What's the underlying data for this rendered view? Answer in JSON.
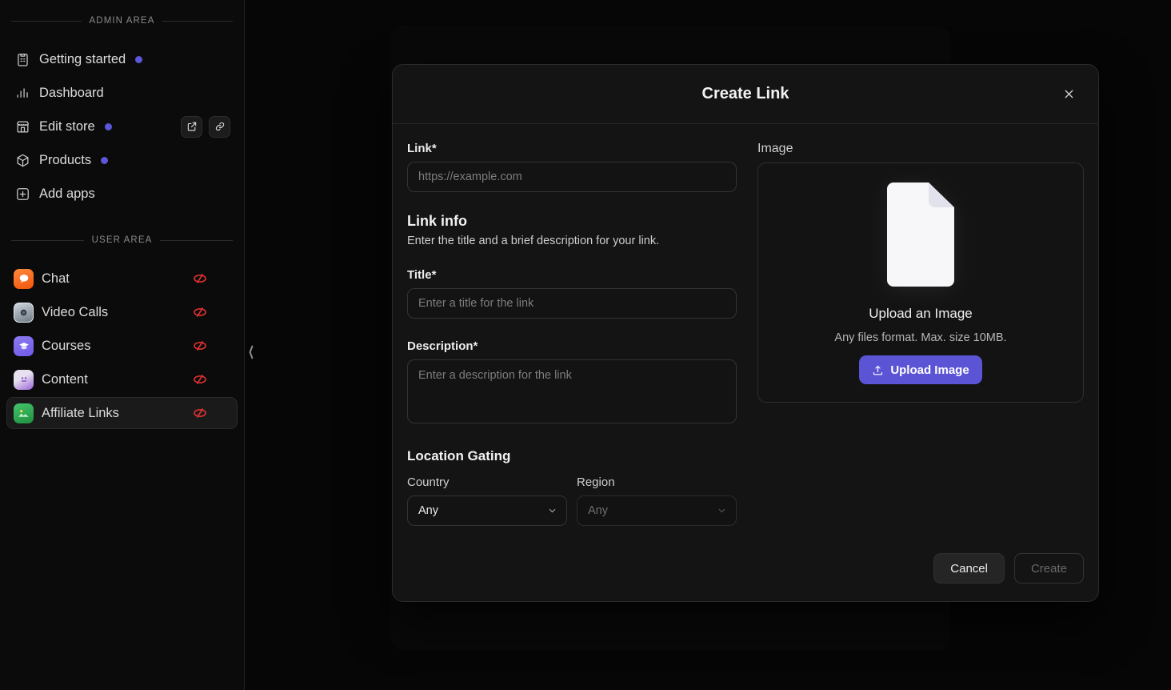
{
  "sidebar": {
    "admin_section": {
      "label": "ADMIN AREA",
      "items": [
        {
          "label": "Getting started",
          "icon": "clipboard-icon",
          "dot": true
        },
        {
          "label": "Dashboard",
          "icon": "bar-chart-icon",
          "dot": false
        },
        {
          "label": "Edit store",
          "icon": "store-icon",
          "dot": true
        },
        {
          "label": "Products",
          "icon": "package-icon",
          "dot": true
        },
        {
          "label": "Add apps",
          "icon": "plus-square-icon",
          "dot": false
        }
      ],
      "store_actions": [
        {
          "name": "external-link",
          "icon": "external-link-icon"
        },
        {
          "name": "copy-link",
          "icon": "chain-link-icon"
        }
      ]
    },
    "user_section": {
      "label": "USER AREA",
      "items": [
        {
          "label": "Chat",
          "emoji": "💬",
          "hidden": true,
          "selected": false
        },
        {
          "label": "Video Calls",
          "emoji": "📷",
          "hidden": true,
          "selected": false
        },
        {
          "label": "Courses",
          "emoji": "🎓",
          "hidden": true,
          "selected": false
        },
        {
          "label": "Content",
          "emoji": "🎭",
          "hidden": true,
          "selected": false
        },
        {
          "label": "Affiliate Links",
          "emoji": "🌄",
          "hidden": true,
          "selected": true
        }
      ]
    },
    "collapse_handle": "chevron-left-icon"
  },
  "modal": {
    "title": "Create Link",
    "close_icon": "close-icon",
    "link_field": {
      "label": "Link*",
      "placeholder": "https://example.com",
      "value": ""
    },
    "link_info": {
      "heading": "Link info",
      "description": "Enter the title and a brief description for your link."
    },
    "title_field": {
      "label": "Title*",
      "placeholder": "Enter a title for the link",
      "value": ""
    },
    "description_field": {
      "label": "Description*",
      "placeholder": "Enter a description for the link",
      "value": ""
    },
    "location_gating": {
      "heading": "Location Gating",
      "country": {
        "label": "Country",
        "value": "Any",
        "disabled": false
      },
      "region": {
        "label": "Region",
        "value": "Any",
        "disabled": true
      }
    },
    "image": {
      "label": "Image",
      "upload_title": "Upload an Image",
      "upload_hint": "Any files format. Max. size 10MB.",
      "upload_button": "Upload Image",
      "upload_icon": "upload-icon",
      "file_glyph": "file-icon"
    },
    "footer": {
      "cancel": "Cancel",
      "create": "Create",
      "create_disabled": true
    }
  },
  "colors": {
    "accent": "#5b55d6",
    "badge_dot": "#5b57d8",
    "hidden_icon": "#e03131",
    "modal_bg": "#141414",
    "sidebar_bg": "#0b0b0b"
  }
}
